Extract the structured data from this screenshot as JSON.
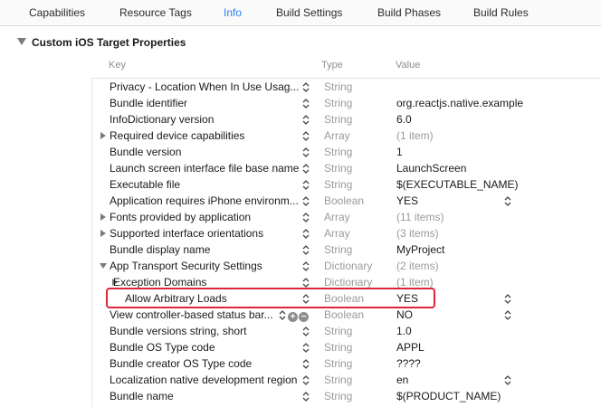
{
  "tabs": [
    "Capabilities",
    "Resource Tags",
    "Info",
    "Build Settings",
    "Build Phases",
    "Build Rules"
  ],
  "active_tab": "Info",
  "section": {
    "title": "Custom iOS Target Properties"
  },
  "columns": {
    "key": "Key",
    "type": "Type",
    "value": "Value"
  },
  "rows": [
    {
      "key": "Privacy - Location When In Use Usag...",
      "type": "String",
      "value": ""
    },
    {
      "key": "Bundle identifier",
      "type": "String",
      "value": "org.reactjs.native.example"
    },
    {
      "key": "InfoDictionary version",
      "type": "String",
      "value": "6.0"
    },
    {
      "key": "Required device capabilities",
      "type": "Array",
      "value": "(1 item)"
    },
    {
      "key": "Bundle version",
      "type": "String",
      "value": "1"
    },
    {
      "key": "Launch screen interface file base name",
      "type": "String",
      "value": "LaunchScreen"
    },
    {
      "key": "Executable file",
      "type": "String",
      "value": "$(EXECUTABLE_NAME)"
    },
    {
      "key": "Application requires iPhone environm...",
      "type": "Boolean",
      "value": "YES"
    },
    {
      "key": "Fonts provided by application",
      "type": "Array",
      "value": "(11 items)"
    },
    {
      "key": "Supported interface orientations",
      "type": "Array",
      "value": "(3 items)"
    },
    {
      "key": "Bundle display name",
      "type": "String",
      "value": "MyProject"
    },
    {
      "key": "App Transport Security Settings",
      "type": "Dictionary",
      "value": "(2 items)"
    },
    {
      "key": "Exception Domains",
      "type": "Dictionary",
      "value": "(1 item)"
    },
    {
      "key": "Allow Arbitrary Loads",
      "type": "Boolean",
      "value": "YES"
    },
    {
      "key": "View controller-based status bar...",
      "type": "Boolean",
      "value": "NO"
    },
    {
      "key": "Bundle versions string, short",
      "type": "String",
      "value": "1.0"
    },
    {
      "key": "Bundle OS Type code",
      "type": "String",
      "value": "APPL"
    },
    {
      "key": "Bundle creator OS Type code",
      "type": "String",
      "value": "????"
    },
    {
      "key": "Localization native development region",
      "type": "String",
      "value": "en"
    },
    {
      "key": "Bundle name",
      "type": "String",
      "value": "$(PRODUCT_NAME)"
    }
  ],
  "colors": {
    "accent": "#2a7ff5",
    "highlight": "#e0243c",
    "muted": "#9a9a9a"
  }
}
